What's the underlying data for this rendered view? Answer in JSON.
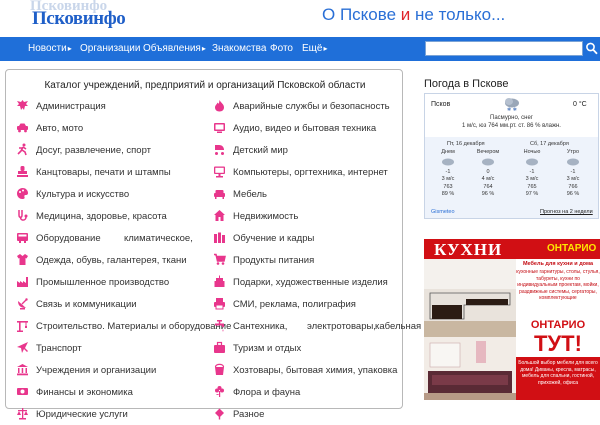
{
  "header": {
    "logo_ghost": "Псковинфо",
    "logo": "Псковинфо",
    "tagline_a": "О Пскове ",
    "tagline_b": "и",
    "tagline_c": " не только..."
  },
  "nav": {
    "items": [
      {
        "label": "Новости",
        "has_arrow": true
      },
      {
        "label": "Организации",
        "has_arrow": false
      },
      {
        "label": "Объявления",
        "has_arrow": true
      },
      {
        "label": "Знакомства",
        "has_arrow": false
      },
      {
        "label": "Фото",
        "has_arrow": false
      },
      {
        "label": "Ещё",
        "has_arrow": true
      }
    ],
    "arrow": "▸",
    "search_placeholder": ""
  },
  "catalog": {
    "title": "Каталог учреждений, предприятий и организаций Псковской области",
    "left": [
      {
        "label": "Администрация",
        "icon": "eagle-icon"
      },
      {
        "label": "Авто, мото",
        "icon": "car-icon"
      },
      {
        "label": "Досуг, развлечение, спорт",
        "icon": "running-man-icon"
      },
      {
        "label": "Канцтовары, печати и штампы",
        "icon": "stamp-icon"
      },
      {
        "label": "Культура и искусство",
        "icon": "palette-icon"
      },
      {
        "label": "Медицина, здоровье, красота",
        "icon": "medical-icon"
      },
      {
        "label": "Оборудование",
        "label_b": "климатическое,",
        "icon": "equipment-icon"
      },
      {
        "label": "Одежда, обувь, галантерея, ткани",
        "icon": "shirt-icon"
      },
      {
        "label": "Промышленное производство",
        "icon": "factory-icon"
      },
      {
        "label": "Связь и коммуникации",
        "icon": "satellite-icon"
      },
      {
        "label": "Строительство. Материалы и оборудование",
        "icon": "crane-icon"
      },
      {
        "label": "Транспорт",
        "icon": "plane-icon"
      },
      {
        "label": "Учреждения и организации",
        "icon": "building-icon"
      },
      {
        "label": "Финансы и экономика",
        "icon": "money-icon"
      },
      {
        "label": "Юридические услуги",
        "icon": "law-icon"
      }
    ],
    "right": [
      {
        "label": "Аварийные службы и безопасность",
        "icon": "fire-icon"
      },
      {
        "label": "Аудио, видео и бытовая техника",
        "icon": "tv-icon"
      },
      {
        "label": "Детский мир",
        "icon": "stroller-icon"
      },
      {
        "label": "Компьютеры, оргтехника, интернет",
        "icon": "computer-icon"
      },
      {
        "label": "Мебель",
        "icon": "sofa-icon"
      },
      {
        "label": "Недвижимость",
        "icon": "house-icon"
      },
      {
        "label": "Обучение и кадры",
        "icon": "books-icon"
      },
      {
        "label": "Продукты питания",
        "icon": "cart-icon"
      },
      {
        "label": "Подарки, художественные изделия",
        "icon": "cake-icon"
      },
      {
        "label": "СМИ, реклама, полиграфия",
        "icon": "printer-icon"
      },
      {
        "label": "Сантехника,",
        "label_b": "электротовары,",
        "label_c": "кабельная",
        "icon": "faucet-icon"
      },
      {
        "label": "Туризм и отдых",
        "icon": "suitcase-icon"
      },
      {
        "label": "Хозтовары, бытовая химия, упаковка",
        "icon": "bucket-icon"
      },
      {
        "label": "Флора и фауна",
        "icon": "flower-icon"
      },
      {
        "label": "Разное",
        "icon": "misc-icon"
      }
    ]
  },
  "weather": {
    "title": "Погода в Пскове",
    "city": "Псков",
    "temp": "0 °C",
    "desc": "Пасмурно, снег",
    "sub": "1 м/с, юз   764 мм.рт. ст.   86 % влажн.",
    "day1": "Пт, 16 декабря",
    "day2": "Сб, 17 декабря",
    "cols": [
      {
        "name": "Днем",
        "t": "-1",
        "wind": "3 м/с",
        "p": "763",
        "h": "89 %"
      },
      {
        "name": "Вечером",
        "t": "0",
        "wind": "4 м/с",
        "p": "764",
        "h": "96 %"
      },
      {
        "name": "Ночью",
        "t": "-1",
        "wind": "3 м/с",
        "p": "765",
        "h": "97 %"
      },
      {
        "name": "Утро",
        "t": "-1",
        "wind": "3 м/с",
        "p": "766",
        "h": "96 %"
      }
    ],
    "provider": "Gismeteo",
    "forecast_link": "Прогноз на 2 недели"
  },
  "ad": {
    "kuhni": "КУХНИ",
    "ontario": "ОНТАРИО",
    "sub": "Мебель для кухни и дома",
    "list": "кухонные гарнитуры, столы, стулья, табуреты, кухни по индивидуальным проектам, мойки, раздвижные системы, сергаторы, комплектующие",
    "ontario2": "ОНТАРИО",
    "tut": "ТУТ!",
    "bottom": "Большой выбор мебели для всего дома! Диваны, кресла, матрасы, мебель для спальни, гостиной, прихожей, офиса"
  },
  "colors": {
    "nav_bg": "#1f6fd9",
    "icon_pink": "#e8368c",
    "ad_red": "#d10f14"
  }
}
